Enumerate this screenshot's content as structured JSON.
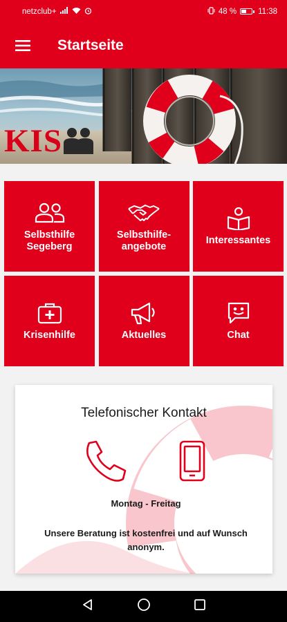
{
  "status_bar": {
    "carrier": "netzclub+",
    "battery": "48 %",
    "time": "11:38",
    "battery_level": 0.48
  },
  "app_bar": {
    "title": "Startseite",
    "menu_icon": "hamburger-menu-icon"
  },
  "banner": {
    "logo_text": "KIS"
  },
  "tiles": [
    {
      "label": "Selbsthilfe\nSegeberg",
      "icon": "people-icon"
    },
    {
      "label": "Selbsthilfe-\nangebote",
      "icon": "handshake-icon"
    },
    {
      "label": "Interessantes",
      "icon": "reading-person-icon"
    },
    {
      "label": "Krisenhilfe",
      "icon": "first-aid-kit-icon"
    },
    {
      "label": "Aktuelles",
      "icon": "megaphone-icon"
    },
    {
      "label": "Chat",
      "icon": "chat-smiley-icon"
    }
  ],
  "contact": {
    "title": "Telefonischer Kontakt",
    "hours": "Montag - Freitag",
    "note": "Unsere Beratung ist kostenfrei und auf Wunsch anonym.",
    "phone_icon": "phone-icon",
    "mobile_icon": "mobile-phone-icon"
  },
  "colors": {
    "primary": "#e0001b",
    "white": "#ffffff",
    "nav_bar": "#000000"
  }
}
